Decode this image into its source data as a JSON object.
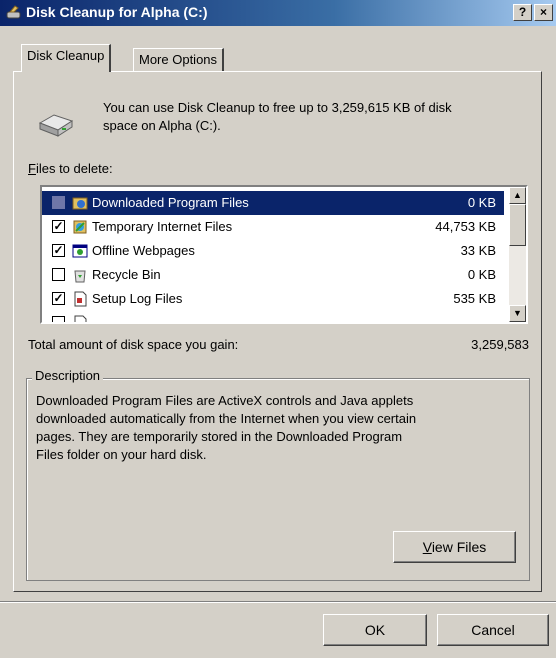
{
  "window": {
    "title": "Disk Cleanup for Alpha (C:)",
    "help_button": "?",
    "close_button": "×"
  },
  "tabs": [
    {
      "label": "Disk Cleanup"
    },
    {
      "label": "More Options"
    }
  ],
  "intro_text_line1": "You can use Disk Cleanup to free up to 3,259,615 KB of disk",
  "intro_text_line2": "space on Alpha (C:).",
  "files_label_accel": "F",
  "files_label_rest": "iles to delete:",
  "files": [
    {
      "name": "Downloaded Program Files",
      "size": "0 KB",
      "checked": false,
      "selected": true,
      "icon": "downloaded-files-icon"
    },
    {
      "name": "Temporary Internet Files",
      "size": "44,753 KB",
      "checked": true,
      "selected": false,
      "icon": "internet-files-icon"
    },
    {
      "name": "Offline Webpages",
      "size": "33 KB",
      "checked": true,
      "selected": false,
      "icon": "offline-webpages-icon"
    },
    {
      "name": "Recycle Bin",
      "size": "0 KB",
      "checked": false,
      "selected": false,
      "icon": "recycle-bin-icon"
    },
    {
      "name": "Setup Log Files",
      "size": "535 KB",
      "checked": true,
      "selected": false,
      "icon": "log-file-icon"
    }
  ],
  "total_label": "Total amount of disk space you gain:",
  "total_value": "3,259,583",
  "description": {
    "label": "Description",
    "line1": "Downloaded Program Files are ActiveX controls and Java applets",
    "line2": "downloaded automatically from the Internet when you view certain",
    "line3": "pages. They are temporarily stored in the Downloaded Program",
    "line4": "Files folder on your hard disk."
  },
  "view_files": {
    "accel": "V",
    "rest": "iew Files"
  },
  "ok_label": "OK",
  "cancel_label": "Cancel"
}
